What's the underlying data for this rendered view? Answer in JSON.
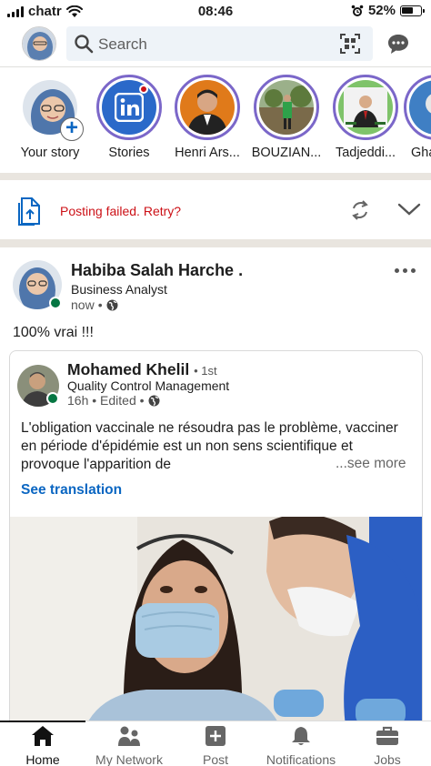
{
  "status_bar": {
    "carrier": "chatr",
    "time": "08:46",
    "battery": "52%"
  },
  "search": {
    "placeholder": "Search"
  },
  "stories": [
    {
      "label": "Your story"
    },
    {
      "label": "Stories"
    },
    {
      "label": "Henri Ars..."
    },
    {
      "label": "BOUZIAN..."
    },
    {
      "label": "Tadjeddi..."
    },
    {
      "label": "Gha..."
    }
  ],
  "posting_status": {
    "text": "Posting failed. Retry?"
  },
  "post": {
    "author": "Habiba Salah Harche .",
    "headline": "Business Analyst",
    "time": "now",
    "text": "100% vrai !!!",
    "shared": {
      "author": "Mohamed Khelil",
      "degree": "• 1st",
      "headline": "Quality Control Management",
      "time": "16h • Edited •",
      "body": "L'obligation vaccinale ne résoudra pas le problème, vacciner en période d'épidémie est un non sens scientifique et provoque l'apparition de",
      "see_more": "...see more",
      "translate": "See translation"
    }
  },
  "bottom_nav": [
    {
      "label": "Home",
      "icon": "home-icon",
      "active": true
    },
    {
      "label": "My Network",
      "icon": "network-icon"
    },
    {
      "label": "Post",
      "icon": "post-icon"
    },
    {
      "label": "Notifications",
      "icon": "bell-icon"
    },
    {
      "label": "Jobs",
      "icon": "briefcase-icon"
    }
  ],
  "colors": {
    "accent": "#0a66c2",
    "error": "#cc1016",
    "online": "#057642",
    "story_ring": "#7b67c9"
  }
}
